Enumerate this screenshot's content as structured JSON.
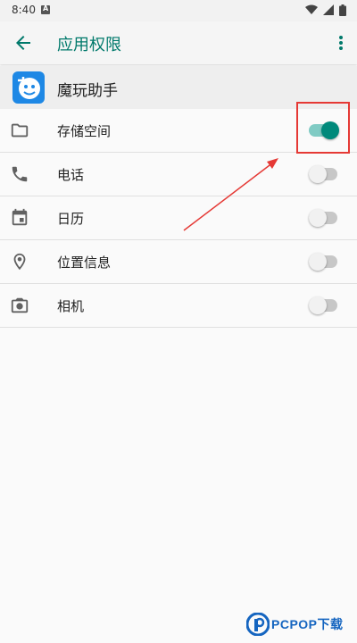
{
  "status_bar": {
    "time": "8:40",
    "notification_icon": "a-icon",
    "right_icons": [
      "wifi-icon",
      "signal-icon",
      "battery-icon"
    ]
  },
  "app_bar": {
    "title": "应用权限",
    "back_icon": "arrow-back-icon",
    "menu_icon": "more-vert-icon"
  },
  "app": {
    "name": "魔玩助手",
    "logo_icon": "app-logo-icon"
  },
  "permissions": [
    {
      "label": "存储空间",
      "icon": "folder-icon",
      "enabled": true
    },
    {
      "label": "电话",
      "icon": "phone-icon",
      "enabled": false
    },
    {
      "label": "日历",
      "icon": "calendar-icon",
      "enabled": false
    },
    {
      "label": "位置信息",
      "icon": "location-icon",
      "enabled": false
    },
    {
      "label": "相机",
      "icon": "camera-icon",
      "enabled": false
    }
  ],
  "watermark": {
    "text": "PCPOP下载"
  },
  "colors": {
    "accent": "#00796b",
    "switch_on_thumb": "#00897b",
    "switch_on_track": "#80cbc4",
    "annotation": "#e53935"
  }
}
